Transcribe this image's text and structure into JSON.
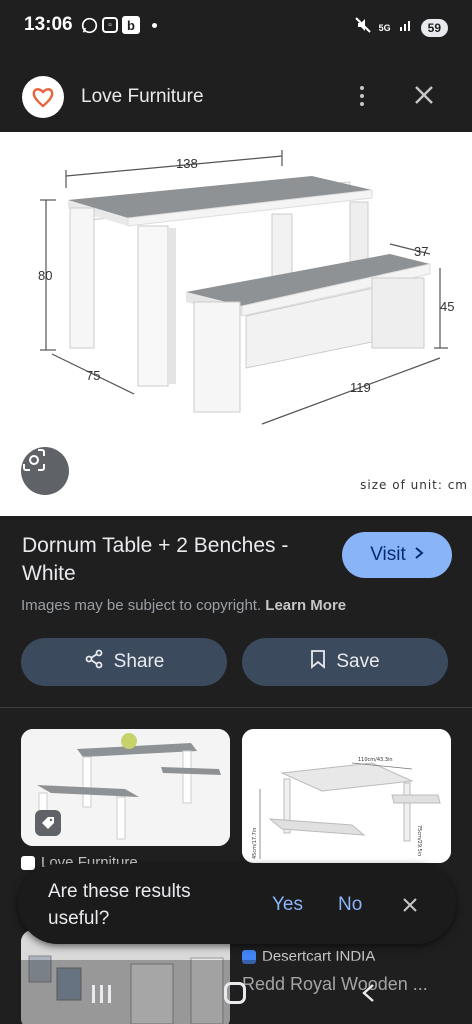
{
  "status": {
    "time": "13:06",
    "network": "5G",
    "battery": "59"
  },
  "app_bar": {
    "site_name": "Love Furniture",
    "more_icon": "more-vert-icon",
    "close_icon": "close-icon"
  },
  "hero": {
    "dim_top": "138",
    "dim_height": "80",
    "dim_depth": "75",
    "bench_depth": "37",
    "bench_height": "45",
    "bench_length": "119",
    "unit_text": "size of unit: cm",
    "table_top_color": "#8f9295",
    "frame_color": "#f2f2f2"
  },
  "product": {
    "title": "Dornum Table + 2 Benches - White",
    "visit_label": "Visit",
    "copyright": "Images may be subject to copyright.",
    "learn_more": "Learn More"
  },
  "actions": {
    "share_label": "Share",
    "save_label": "Save"
  },
  "related": {
    "card1_source": "Love Furniture",
    "card2_dims_top": "110cm/43.3in",
    "card2_dims_side": "75cm/29.5in",
    "card2_dims_left": "45cm/17.7in",
    "card2_source": "Desertcart INDIA",
    "card2_title": "Redd Royal Wooden ..."
  },
  "feedback": {
    "question": "Are these results useful?",
    "yes": "Yes",
    "no": "No"
  },
  "colors": {
    "accent": "#8ab4f8",
    "chip_bg": "#3c4a5e",
    "background": "#1f1f1f"
  }
}
